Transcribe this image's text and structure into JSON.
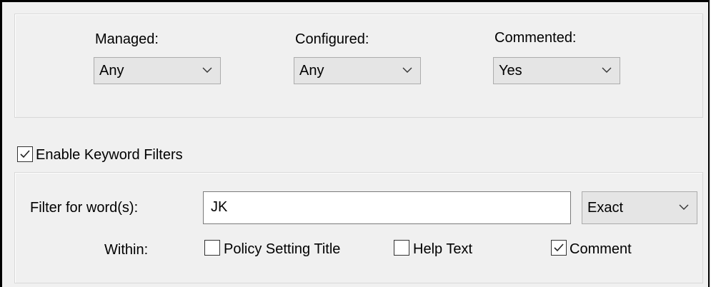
{
  "filters": {
    "managed": {
      "label": "Managed:",
      "value": "Any"
    },
    "configured": {
      "label": "Configured:",
      "value": "Any"
    },
    "commented": {
      "label": "Commented:",
      "value": "Yes"
    }
  },
  "keyword": {
    "enable_label": "Enable Keyword Filters",
    "enabled": true,
    "filter_label": "Filter for word(s):",
    "filter_value": "JK",
    "match_mode": "Exact",
    "within_label": "Within:",
    "within": [
      {
        "label": "Policy Setting Title",
        "checked": false
      },
      {
        "label": "Help Text",
        "checked": false
      },
      {
        "label": "Comment",
        "checked": true
      }
    ]
  },
  "icons": {
    "dropdown": "chevron-down-icon",
    "checkbox_checked": "check-icon"
  },
  "colors": {
    "background": "#f0f0f0",
    "combo_background": "#e5e5e5",
    "textbox_background": "#ffffff"
  }
}
